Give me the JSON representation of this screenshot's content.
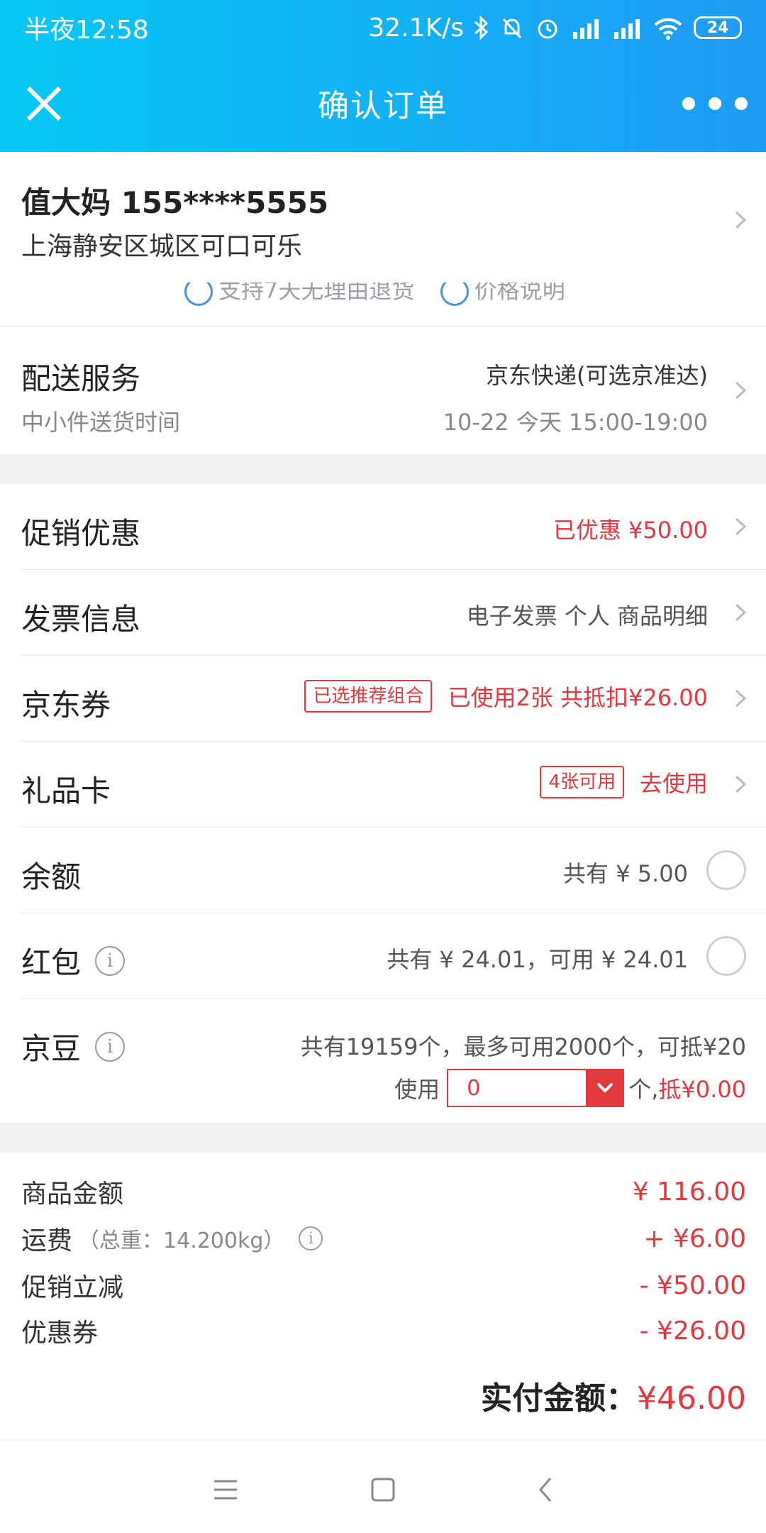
{
  "status_bar": {
    "time": "半夜12:58",
    "speed": "32.1K/s",
    "battery": "24"
  },
  "header": {
    "title": "确认订单"
  },
  "address": {
    "name_phone": "值大妈 155****5555",
    "address": "上海静安区城区可口可乐"
  },
  "partial": {
    "text1": "支持7天无理由退货",
    "text2": "价格说明"
  },
  "delivery": {
    "title": "配送服务",
    "subtitle": "中小件送货时间",
    "service": "京东快递(可选京准达)",
    "time": "10-22 今天 15:00-19:00"
  },
  "options": {
    "promo": {
      "label": "促销优惠",
      "value": "已优惠 ¥50.00"
    },
    "invoice": {
      "label": "发票信息",
      "value": "电子发票 个人 商品明细"
    },
    "coupon": {
      "label": "京东券",
      "tag": "已选推荐组合",
      "value": "已使用2张 共抵扣¥26.00"
    },
    "giftcard": {
      "label": "礼品卡",
      "tag": "4张可用",
      "value": "去使用"
    },
    "balance": {
      "label": "余额",
      "value": "共有 ¥ 5.00"
    },
    "redpacket": {
      "label": "红包",
      "value": "共有 ¥ 24.01，可用 ¥ 24.01"
    },
    "beans": {
      "label": "京豆",
      "line1": "共有19159个，最多可用2000个，可抵¥20",
      "use_label": "使用",
      "input_value": "0",
      "unit": "个,",
      "deduct": "抵¥0.00"
    }
  },
  "summary": {
    "goods_label": "商品金额",
    "goods_value": "¥ 116.00",
    "shipping_label": "运费",
    "shipping_weight": "（总重：14.200kg）",
    "shipping_value": "+ ¥6.00",
    "promo_label": "促销立减",
    "promo_value": "- ¥50.00",
    "coupon_label": "优惠券",
    "coupon_value": "- ¥26.00",
    "total_label": "实付金额：",
    "total_value": "¥46.00"
  },
  "colors": {
    "accent": "#e4393c",
    "header_start": "#06c8f5",
    "header_end": "#1f9bf5"
  }
}
